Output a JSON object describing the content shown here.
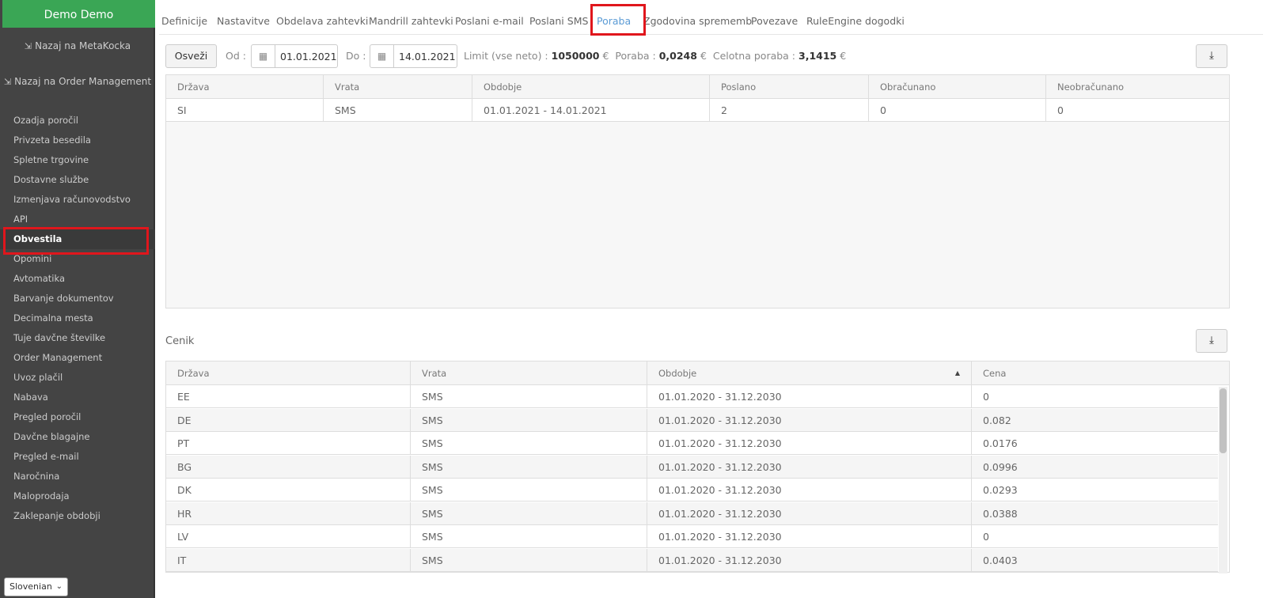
{
  "sidebar": {
    "brand": "Demo Demo",
    "back_links": [
      {
        "label": "Nazaj na MetaKocka"
      },
      {
        "label": "Nazaj na Order Management"
      }
    ],
    "items": [
      {
        "label": "Ozadja poročil"
      },
      {
        "label": "Privzeta besedila"
      },
      {
        "label": "Spletne trgovine"
      },
      {
        "label": "Dostavne službe"
      },
      {
        "label": "Izmenjava računovodstvo"
      },
      {
        "label": "API"
      },
      {
        "label": "Obvestila",
        "active": true
      },
      {
        "label": "Opomini"
      },
      {
        "label": "Avtomatika"
      },
      {
        "label": "Barvanje dokumentov"
      },
      {
        "label": "Decimalna mesta"
      },
      {
        "label": "Tuje davčne številke"
      },
      {
        "label": "Order Management"
      },
      {
        "label": "Uvoz plačil"
      },
      {
        "label": "Nabava"
      },
      {
        "label": "Pregled poročil"
      },
      {
        "label": "Davčne blagajne"
      },
      {
        "label": "Pregled e-mail"
      },
      {
        "label": "Naročnina"
      },
      {
        "label": "Maloprodaja"
      },
      {
        "label": "Zaklepanje obdobji"
      }
    ],
    "language": "Slovenian"
  },
  "tabs": [
    {
      "label": "Definicije"
    },
    {
      "label": "Nastavitve"
    },
    {
      "label": "Obdelava zahtevki"
    },
    {
      "label": "Mandrill zahtevki"
    },
    {
      "label": "Poslani e-mail"
    },
    {
      "label": "Poslani SMS"
    },
    {
      "label": "Poraba",
      "active": true
    },
    {
      "label": "Zgodovina sprememb"
    },
    {
      "label": "Povezave"
    },
    {
      "label": "RuleEngine dogodki"
    }
  ],
  "toolbar": {
    "refresh_label": "Osveži",
    "from_label": "Od :",
    "from_value": "01.01.2021",
    "to_label": "Do :",
    "to_value": "14.01.2021",
    "limit_label": "Limit (vse neto) :",
    "limit_value": "1050000",
    "limit_currency": "€",
    "usage_label": "Poraba :",
    "usage_value": "0,0248",
    "usage_currency": "€",
    "total_label": "Celotna poraba :",
    "total_value": "3,1415",
    "total_currency": "€"
  },
  "usage_table": {
    "columns": [
      "Država",
      "Vrata",
      "Obdobje",
      "Poslano",
      "Obračunano",
      "Neobračunano"
    ],
    "rows": [
      [
        "SI",
        "SMS",
        "01.01.2021 - 14.01.2021",
        "2",
        "0",
        "0"
      ]
    ]
  },
  "pricelist": {
    "title": "Cenik",
    "columns": [
      "Država",
      "Vrata",
      "Obdobje",
      "Cena"
    ],
    "rows": [
      [
        "EE",
        "SMS",
        "01.01.2020 - 31.12.2030",
        "0"
      ],
      [
        "DE",
        "SMS",
        "01.01.2020 - 31.12.2030",
        "0.082"
      ],
      [
        "PT",
        "SMS",
        "01.01.2020 - 31.12.2030",
        "0.0176"
      ],
      [
        "BG",
        "SMS",
        "01.01.2020 - 31.12.2030",
        "0.0996"
      ],
      [
        "DK",
        "SMS",
        "01.01.2020 - 31.12.2030",
        "0.0293"
      ],
      [
        "HR",
        "SMS",
        "01.01.2020 - 31.12.2030",
        "0.0388"
      ],
      [
        "LV",
        "SMS",
        "01.01.2020 - 31.12.2030",
        "0"
      ],
      [
        "IT",
        "SMS",
        "01.01.2020 - 31.12.2030",
        "0.0403"
      ]
    ]
  }
}
